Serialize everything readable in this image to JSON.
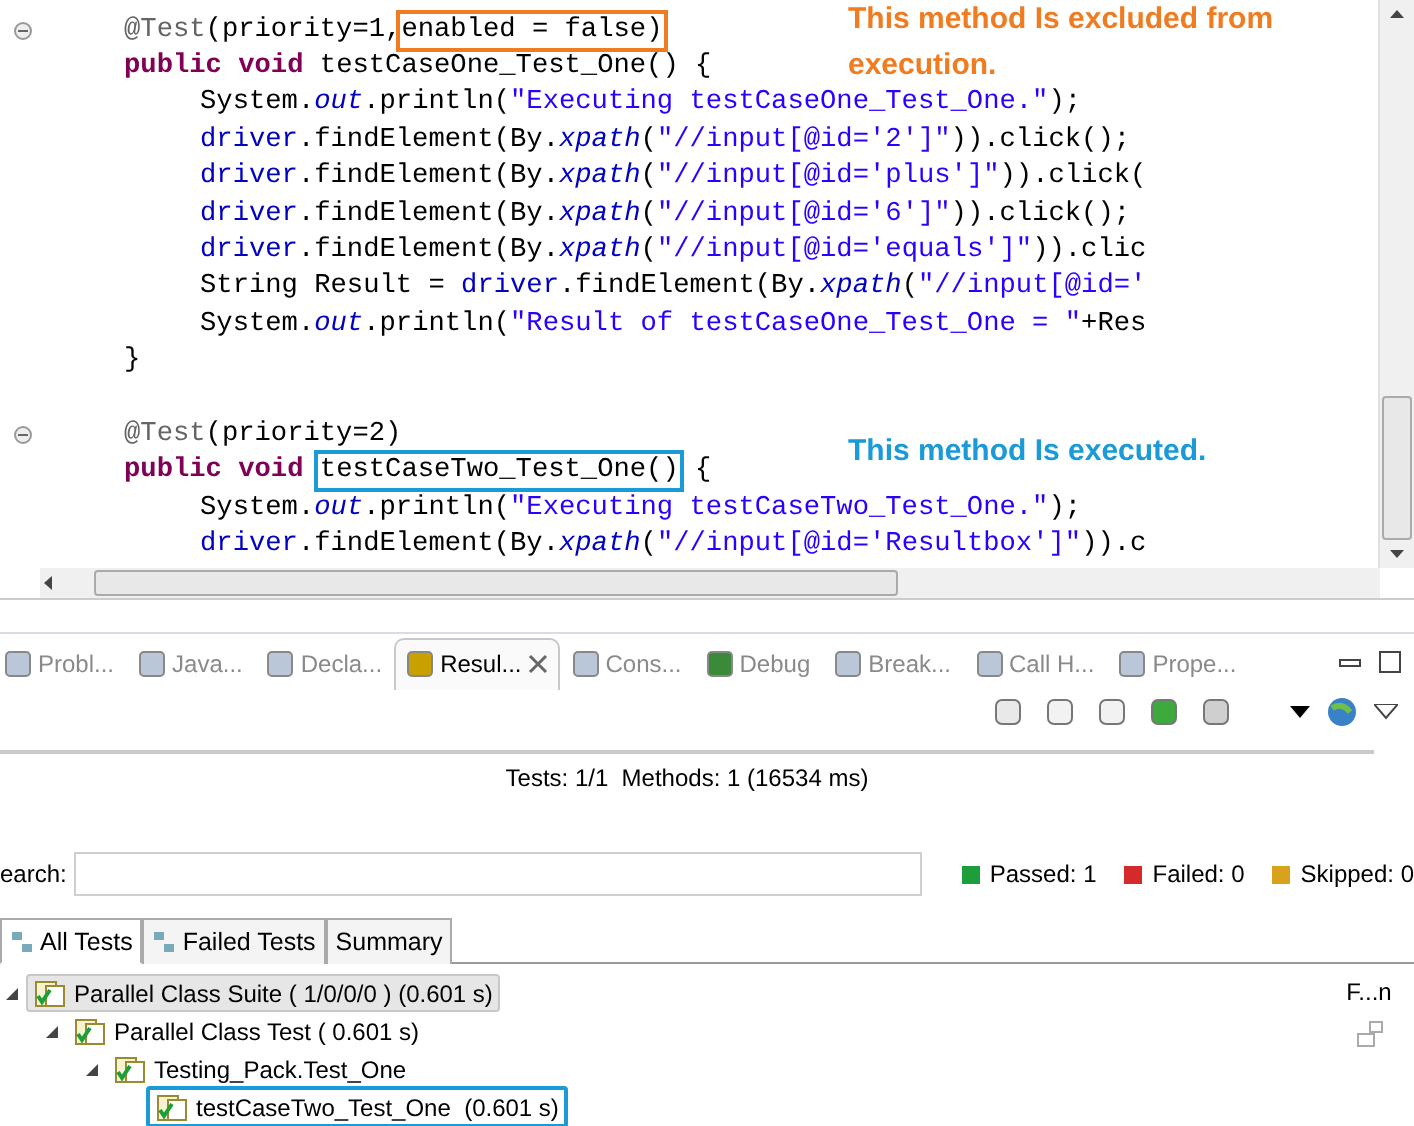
{
  "editor": {
    "lines": [
      {
        "kind": "member",
        "fold": true,
        "segments": [
          {
            "kind": "annotation",
            "text": "@Test"
          },
          {
            "kind": "plain",
            "text": "(priority=1,"
          },
          {
            "kind": "boxed",
            "text": "enabled = false)"
          }
        ]
      },
      {
        "kind": "member",
        "fold": false,
        "segments": [
          {
            "kind": "keyword",
            "text": "public void "
          },
          {
            "kind": "plain",
            "text": "testCaseOne_Test_One() {"
          }
        ]
      },
      {
        "kind": "stmt",
        "fold": false,
        "segments": [
          {
            "kind": "plain",
            "text": "System."
          },
          {
            "kind": "static",
            "text": "out"
          },
          {
            "kind": "plain",
            "text": ".println("
          },
          {
            "kind": "string",
            "text": "\"Executing testCaseOne_Test_One.\""
          },
          {
            "kind": "plain",
            "text": ");"
          }
        ]
      },
      {
        "kind": "stmt",
        "fold": false,
        "segments": [
          {
            "kind": "field",
            "text": "driver"
          },
          {
            "kind": "plain",
            "text": ".findElement(By."
          },
          {
            "kind": "static",
            "text": "xpath"
          },
          {
            "kind": "plain",
            "text": "("
          },
          {
            "kind": "string",
            "text": "\"//input[@id='2']\""
          },
          {
            "kind": "plain",
            "text": ")).click();"
          }
        ]
      },
      {
        "kind": "stmt",
        "fold": false,
        "segments": [
          {
            "kind": "field",
            "text": "driver"
          },
          {
            "kind": "plain",
            "text": ".findElement(By."
          },
          {
            "kind": "static",
            "text": "xpath"
          },
          {
            "kind": "plain",
            "text": "("
          },
          {
            "kind": "string",
            "text": "\"//input[@id='plus']\""
          },
          {
            "kind": "plain",
            "text": ")).click("
          }
        ]
      },
      {
        "kind": "stmt",
        "fold": false,
        "segments": [
          {
            "kind": "field",
            "text": "driver"
          },
          {
            "kind": "plain",
            "text": ".findElement(By."
          },
          {
            "kind": "static",
            "text": "xpath"
          },
          {
            "kind": "plain",
            "text": "("
          },
          {
            "kind": "string",
            "text": "\"//input[@id='6']\""
          },
          {
            "kind": "plain",
            "text": ")).click();"
          }
        ]
      },
      {
        "kind": "stmt",
        "fold": false,
        "segments": [
          {
            "kind": "field",
            "text": "driver"
          },
          {
            "kind": "plain",
            "text": ".findElement(By."
          },
          {
            "kind": "static",
            "text": "xpath"
          },
          {
            "kind": "plain",
            "text": "("
          },
          {
            "kind": "string",
            "text": "\"//input[@id='equals']\""
          },
          {
            "kind": "plain",
            "text": ")).clic"
          }
        ]
      },
      {
        "kind": "stmt",
        "fold": false,
        "segments": [
          {
            "kind": "plain",
            "text": "String Result = "
          },
          {
            "kind": "field",
            "text": "driver"
          },
          {
            "kind": "plain",
            "text": ".findElement(By."
          },
          {
            "kind": "static",
            "text": "xpath"
          },
          {
            "kind": "plain",
            "text": "("
          },
          {
            "kind": "string",
            "text": "\"//input[@id='"
          }
        ]
      },
      {
        "kind": "stmt",
        "fold": false,
        "segments": [
          {
            "kind": "plain",
            "text": "System."
          },
          {
            "kind": "static",
            "text": "out"
          },
          {
            "kind": "plain",
            "text": ".println("
          },
          {
            "kind": "string",
            "text": "\"Result of testCaseOne_Test_One = \""
          },
          {
            "kind": "plain",
            "text": "+Res"
          }
        ]
      },
      {
        "kind": "member",
        "fold": false,
        "segments": [
          {
            "kind": "plain",
            "text": "}"
          }
        ]
      },
      {
        "kind": "blank",
        "fold": false
      },
      {
        "kind": "member",
        "fold": true,
        "segments": [
          {
            "kind": "annotation",
            "text": "@Test"
          },
          {
            "kind": "plain",
            "text": "(priority=2)"
          }
        ]
      },
      {
        "kind": "member",
        "fold": false,
        "segments": [
          {
            "kind": "keyword",
            "text": "public void "
          },
          {
            "kind": "boxed",
            "text": "testCaseTwo_Test_One()"
          },
          {
            "kind": "plain",
            "text": " {"
          }
        ]
      },
      {
        "kind": "stmt",
        "fold": false,
        "segments": [
          {
            "kind": "plain",
            "text": "System."
          },
          {
            "kind": "static",
            "text": "out"
          },
          {
            "kind": "plain",
            "text": ".println("
          },
          {
            "kind": "string",
            "text": "\"Executing testCaseTwo_Test_One.\""
          },
          {
            "kind": "plain",
            "text": ");"
          }
        ]
      },
      {
        "kind": "stmt",
        "fold": false,
        "segments": [
          {
            "kind": "field",
            "text": "driver"
          },
          {
            "kind": "plain",
            "text": ".findElement(By."
          },
          {
            "kind": "static",
            "text": "xpath"
          },
          {
            "kind": "plain",
            "text": "("
          },
          {
            "kind": "string",
            "text": "\"//input[@id='Resultbox']\""
          },
          {
            "kind": "plain",
            "text": ")).c"
          }
        ]
      }
    ],
    "callouts": [
      {
        "text": "This method Is excluded from execution.",
        "color": "#f07c22"
      },
      {
        "text": "This method Is executed.",
        "color": "#1a9ad6"
      }
    ]
  },
  "view_tabs": [
    {
      "label": "Probl...",
      "selected": false
    },
    {
      "label": "Java...",
      "selected": false
    },
    {
      "label": "Decla...",
      "selected": false
    },
    {
      "label": "Resul...",
      "selected": true
    },
    {
      "label": "Cons...",
      "selected": false
    },
    {
      "label": "Debug",
      "selected": false
    },
    {
      "label": "Break...",
      "selected": false
    },
    {
      "label": "Call H...",
      "selected": false
    },
    {
      "label": "Prope...",
      "selected": false
    }
  ],
  "summary": "Tests: 1/1  Methods: 1 (16534 ms)",
  "search": {
    "label": "earch:"
  },
  "counters": [
    {
      "label": "Passed: 1",
      "color": "#1e9e3a"
    },
    {
      "label": "Failed: 0",
      "color": "#d62a2a"
    },
    {
      "label": "Skipped: 0",
      "color": "#d9a21c"
    }
  ],
  "result_tabs": [
    {
      "label": "All Tests",
      "selected": true
    },
    {
      "label": "Failed Tests",
      "selected": false
    },
    {
      "label": "Summary",
      "selected": false
    }
  ],
  "tree": [
    {
      "label": "Parallel Class Suite ( 1/0/0/0 ) (0.601 s)",
      "selected": true,
      "kind": "plain",
      "children": [
        {
          "label": "Parallel Class Test ( 0.601 s)",
          "selected": false,
          "kind": "plain",
          "children": [
            {
              "label": "Testing_Pack.Test_One",
              "selected": false,
              "kind": "plain",
              "children": [
                {
                  "label": "testCaseTwo_Test_One  (0.601 s)",
                  "selected": false,
                  "kind": "boxed"
                }
              ]
            }
          ]
        }
      ]
    }
  ],
  "side_label": "F...n"
}
